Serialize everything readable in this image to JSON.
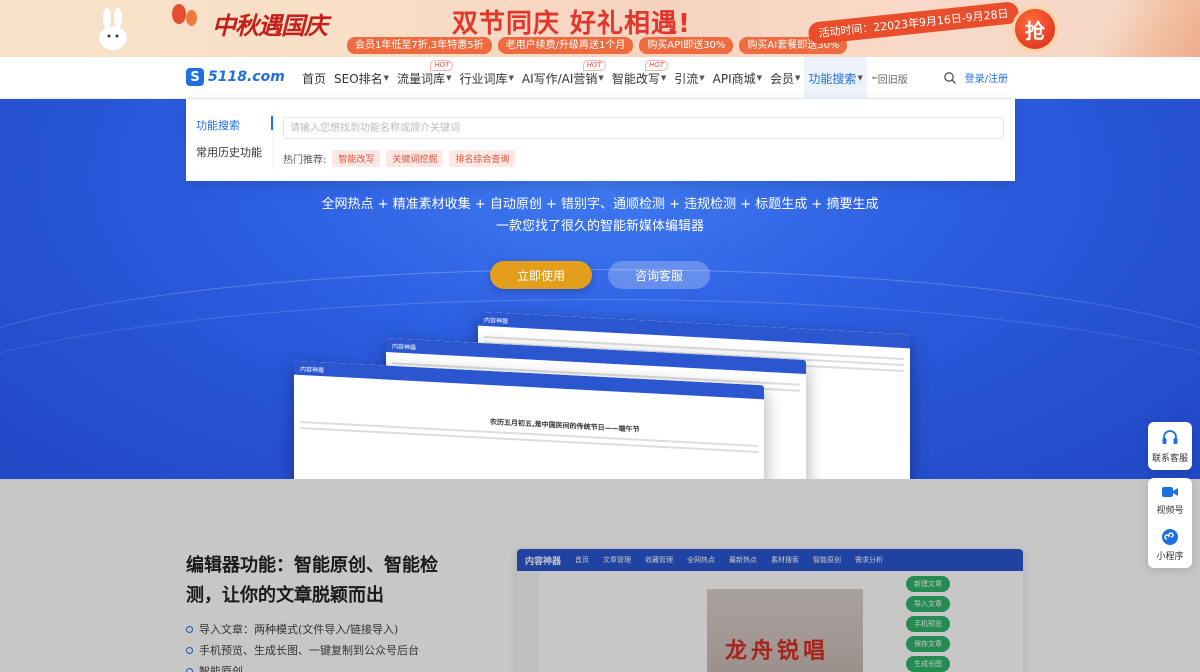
{
  "banner": {
    "festival": "中秋遇国庆",
    "headline": "双节同庆 好礼相遇!",
    "promos": [
      "会员1年低至7折,3年特惠5折",
      "老用户续费/升级再送1个月",
      "购买API即送30%",
      "购买AI套餐即送30%"
    ],
    "event_time": "活动时间：22023年9月16日-9月28日",
    "grab_label": "抢"
  },
  "nav": {
    "logo_mark": "S",
    "logo_text": "5118.com",
    "items": [
      {
        "label": "首页",
        "caret": false,
        "hot": false
      },
      {
        "label": "SEO排名",
        "caret": true,
        "hot": false
      },
      {
        "label": "流量词库",
        "caret": true,
        "hot": true
      },
      {
        "label": "行业词库",
        "caret": true,
        "hot": false
      },
      {
        "label": "AI写作/AI营销",
        "caret": true,
        "hot": true
      },
      {
        "label": "智能改写",
        "caret": true,
        "hot": true
      },
      {
        "label": "引流",
        "caret": true,
        "hot": false
      },
      {
        "label": "API商城",
        "caret": true,
        "hot": false
      },
      {
        "label": "会员",
        "caret": true,
        "hot": false
      },
      {
        "label": "功能搜索",
        "caret": true,
        "hot": false
      },
      {
        "label": "回旧版",
        "caret": false,
        "hot": false
      }
    ],
    "hot_badge": "HOT",
    "login": "登录/注册"
  },
  "dropdown": {
    "tabs": [
      "功能搜索",
      "常用历史功能"
    ],
    "search_placeholder": "请输入您想找到功能名称或简介关键词",
    "hot_label": "热门推荐:",
    "hot_tags": [
      "智能改写",
      "关键词挖掘",
      "排名综合查询"
    ]
  },
  "hero": {
    "tagline1": "全网热点 + 精准素材收集 + 自动原创 + 错别字、通顺检测 + 违规检测 + 标题生成 + 摘要生成",
    "tagline2": "一款您找了很久的智能新媒体编辑器",
    "primary_btn": "立即使用",
    "secondary_btn": "咨询客服",
    "mock_article_title": "农历五月初五,是中国民间的传统节日——端午节"
  },
  "float_panel": {
    "service": "联系客服",
    "video": "视频号",
    "mini": "小程序"
  },
  "lower": {
    "heading": "编辑器功能：智能原创、智能检测，让你的文章脱颖而出",
    "features": [
      "导入文章：两种模式(文件导入/链接导入)",
      "手机预览、生成长图、一键复制到公众号后台",
      "智能原创"
    ],
    "editor_brand": "内容神器",
    "editor_tabs": [
      "首页",
      "文章管理",
      "收藏管理",
      "全网热点",
      "最新热点",
      "素材搜索",
      "智能原创",
      "需求分析"
    ],
    "editor_actions": [
      "新建文章",
      "导入文章",
      "手机预览",
      "保存文章",
      "生成长图"
    ],
    "editor_art": "龙舟锐唱"
  },
  "colors": {
    "brand": "#1f6fe0",
    "hero_bg": "#2d5fe2",
    "primary_btn": "#e39e1c",
    "hot": "#e94d3a"
  }
}
